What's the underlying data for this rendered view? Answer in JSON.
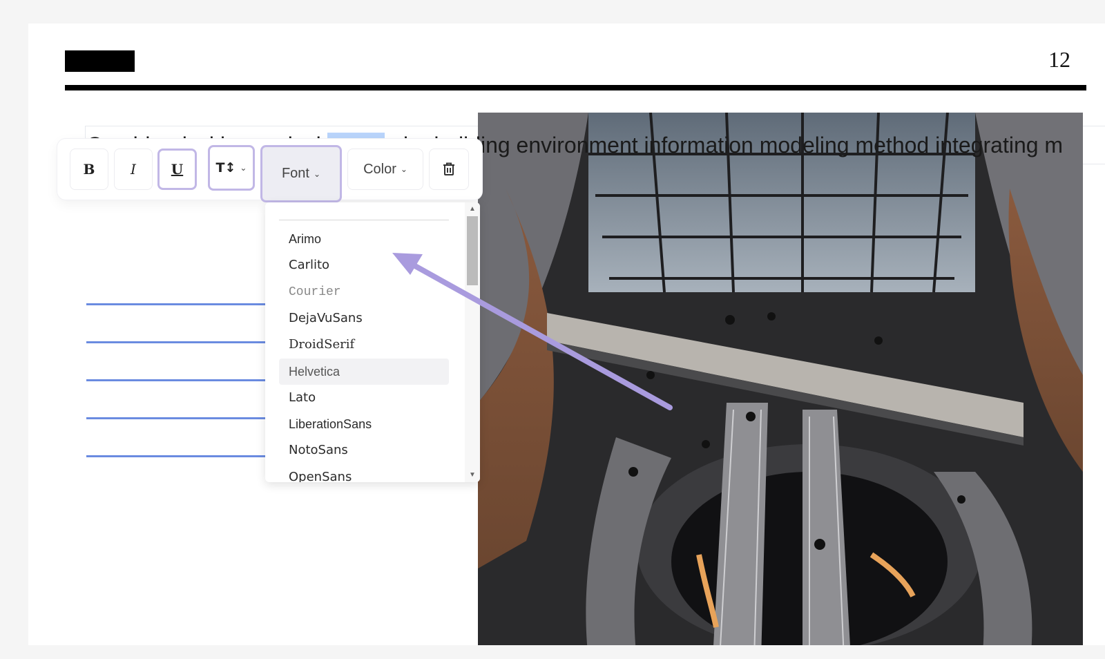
{
  "header": {
    "page_number": "12"
  },
  "body": {
    "text_before": "Combined with practical ",
    "text_selected": "cases",
    "text_after": ", the building environment information modeling method integrating m"
  },
  "toolbar": {
    "bold_label": "B",
    "italic_label": "I",
    "underline_label": "U",
    "size_label": "T↕",
    "font_label": "Font",
    "color_label": "Color",
    "delete_icon": "trash-icon"
  },
  "font_dropdown": {
    "items": [
      "Arimo",
      "Carlito",
      "Courier",
      "DejaVuSans",
      "DroidSerif",
      "Helvetica",
      "Lato",
      "LiberationSans",
      "NotoSans",
      "OpenSans"
    ],
    "hovered": "Helvetica"
  },
  "colors": {
    "selection": "#b9d4fb",
    "highlight_border": "#c1b7e6",
    "blue_lines": "#6a8be0",
    "arrow": "#a99bde"
  }
}
